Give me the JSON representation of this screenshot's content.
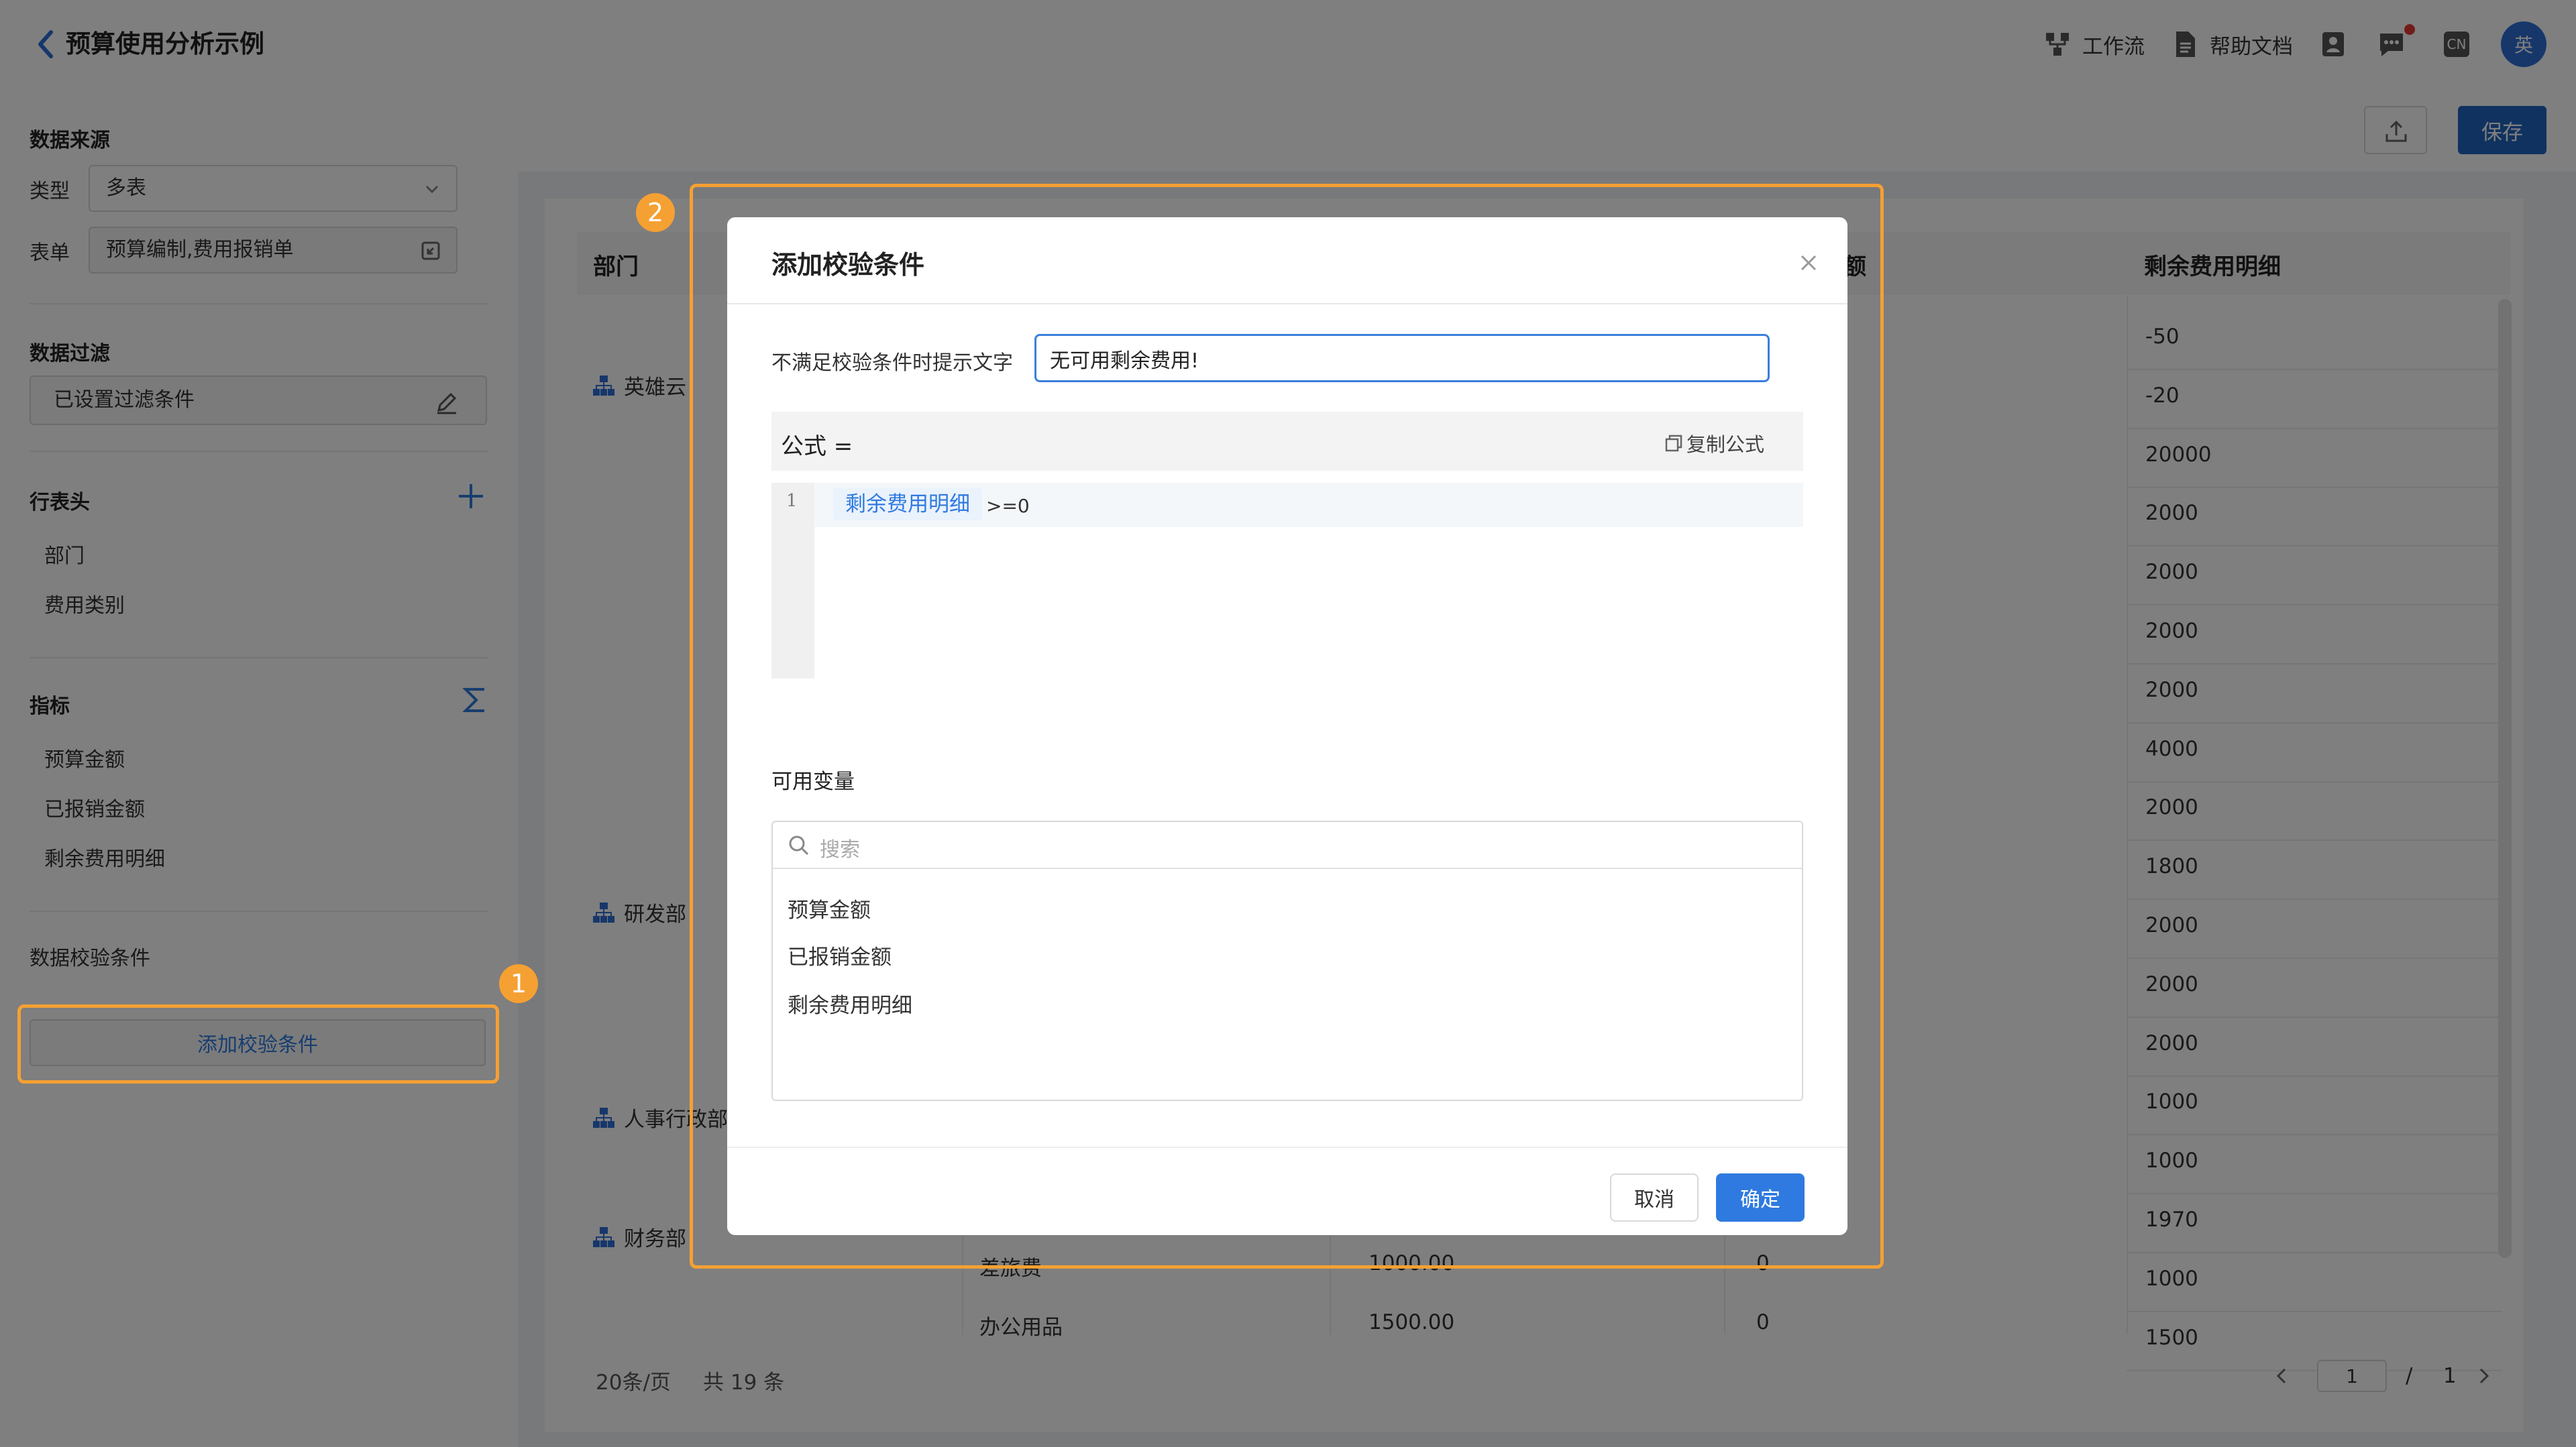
{
  "header": {
    "title": "预算使用分析示例",
    "nav": [
      {
        "label": "工作流",
        "icon": "workflow-icon"
      },
      {
        "label": "帮助文档",
        "icon": "document-icon"
      }
    ],
    "lang": "CN",
    "avatar": "英"
  },
  "left": {
    "data_source": {
      "title": "数据来源",
      "type_label": "类型",
      "type_value": "多表",
      "form_label": "表单",
      "form_value": "预算编制,费用报销单"
    },
    "filter": {
      "title": "数据过滤",
      "value": "已设置过滤条件"
    },
    "row_header": {
      "title": "行表头",
      "items": [
        "部门",
        "费用类别"
      ]
    },
    "metrics": {
      "title": "指标",
      "items": [
        "预算金额",
        "已报销金额",
        "剩余费用明细"
      ]
    },
    "validation": {
      "title": "数据校验条件",
      "add_button": "添加校验条件"
    }
  },
  "toolbar": {
    "save_label": "保存"
  },
  "table": {
    "col_dept": "部门",
    "col_partial": "额",
    "col_remaining": "剩余费用明细",
    "depts": [
      "英雄云",
      "研发部",
      "人事行政部",
      "财务部"
    ],
    "remaining_values": [
      "-50",
      "-20",
      "20000",
      "2000",
      "2000",
      "2000",
      "2000",
      "4000",
      "2000",
      "1800",
      "2000",
      "2000",
      "2000",
      "1000",
      "1000",
      "1970",
      "1000",
      "1500"
    ],
    "bottom_rows": [
      {
        "category": "差旅费",
        "budget": "1000.00",
        "reimbursed": "0"
      },
      {
        "category": "办公用品",
        "budget": "1500.00",
        "reimbursed": "0"
      }
    ],
    "pagination": {
      "page_size": "20条/页",
      "total": "共 19 条",
      "page": "1",
      "sep": "/",
      "pages": "1"
    }
  },
  "modal": {
    "title": "添加校验条件",
    "prompt_label": "不满足校验条件时提示文字",
    "prompt_value": "无可用剩余费用!",
    "formula_label": "公式 =",
    "copy_label": "复制公式",
    "line_number": "1",
    "formula_field": "剩余费用明细",
    "formula_op": ">=0",
    "vars_title": "可用变量",
    "search_placeholder": "搜索",
    "vars": [
      "预算金额",
      "已报销金额",
      "剩余费用明细"
    ],
    "cancel": "取消",
    "ok": "确定"
  },
  "annotations": {
    "badge1": "1",
    "badge2": "2"
  },
  "colors": {
    "primary": "#2f7ae0",
    "highlight": "#f5a033",
    "save": "#2064c0"
  }
}
